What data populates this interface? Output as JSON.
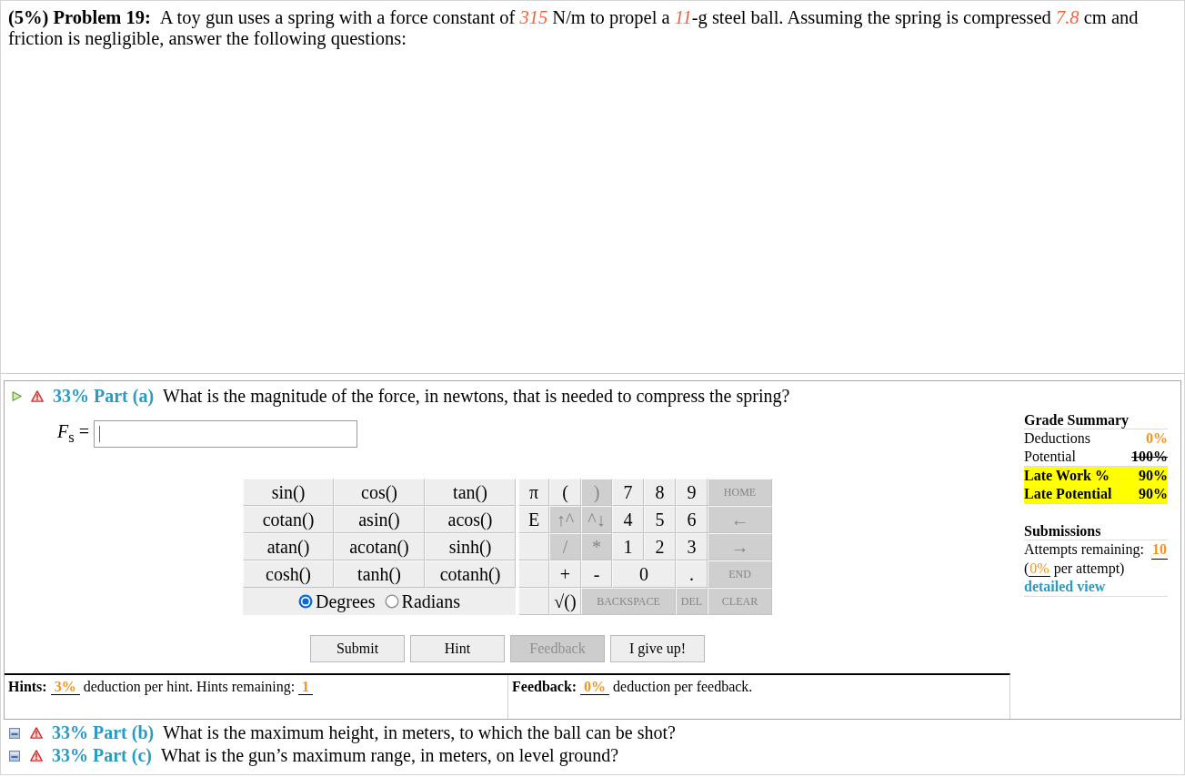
{
  "problem": {
    "heading": "(5%) Problem 19:",
    "statement": [
      {
        "text": "A toy gun uses a spring with a force constant of ",
        "kind": "plain"
      },
      {
        "text": "315",
        "kind": "given"
      },
      {
        "text": " N/m to propel a ",
        "kind": "plain"
      },
      {
        "text": "11",
        "kind": "given"
      },
      {
        "text": "-g steel ball. Assuming the spring is compressed ",
        "kind": "plain"
      },
      {
        "text": "7.8",
        "kind": "given"
      },
      {
        "text": " cm and friction is negligible, answer the following questions:",
        "kind": "plain"
      }
    ]
  },
  "parts": [
    {
      "label": "33% Part (a)",
      "question": "What is the magnitude of the force, in newtons, that is needed to compress the spring?",
      "expanded": true,
      "answer": {
        "variable": "*F*$_{s}$ =",
        "focused": true
      },
      "calculator": {
        "functions": [
          "sin()",
          "cos()",
          "tan()",
          "cotan()",
          "asin()",
          "acos()",
          "atan()",
          "acotan()",
          "sinh()",
          "cosh()",
          "tanh()",
          "cotanh()"
        ],
        "angle_modes": [
          {
            "label": "Degrees",
            "selected": true
          },
          {
            "label": "Radians",
            "selected": false
          }
        ],
        "keypad": [
          [
            {
              "label": "π",
              "kind": "key",
              "disabled": false
            },
            {
              "label": "(",
              "kind": "key",
              "disabled": false
            },
            {
              "label": ")",
              "kind": "key",
              "disabled": true
            },
            {
              "label": "7",
              "kind": "key",
              "disabled": false
            },
            {
              "label": "8",
              "kind": "key",
              "disabled": false
            },
            {
              "label": "9",
              "kind": "key",
              "disabled": false
            },
            {
              "label": "HOME",
              "kind": "command",
              "disabled": true
            }
          ],
          [
            {
              "label": "E",
              "kind": "key",
              "disabled": false
            },
            {
              "label": "↑^",
              "kind": "key",
              "disabled": true
            },
            {
              "label": "^↓",
              "kind": "key",
              "disabled": true
            },
            {
              "label": "4",
              "kind": "key",
              "disabled": false
            },
            {
              "label": "5",
              "kind": "key",
              "disabled": false
            },
            {
              "label": "6",
              "kind": "key",
              "disabled": false
            },
            {
              "label": "←",
              "kind": "key",
              "disabled": true
            }
          ],
          [
            {
              "kind": "blank",
              "disabled": false
            },
            {
              "label": "/",
              "kind": "key",
              "disabled": true
            },
            {
              "label": "*",
              "kind": "key",
              "disabled": true
            },
            {
              "label": "1",
              "kind": "key",
              "disabled": false
            },
            {
              "label": "2",
              "kind": "key",
              "disabled": false
            },
            {
              "label": "3",
              "kind": "key",
              "disabled": false
            },
            {
              "label": "→",
              "kind": "key",
              "disabled": true
            }
          ],
          [
            {
              "kind": "blank",
              "disabled": false
            },
            {
              "label": "+",
              "kind": "key",
              "disabled": false
            },
            {
              "label": "-",
              "kind": "key",
              "disabled": false
            },
            {
              "label": "0",
              "kind": "key",
              "disabled": false
            },
            {
              "label": ".",
              "kind": "key",
              "disabled": false
            },
            {
              "label": "END",
              "kind": "command",
              "disabled": true
            }
          ],
          [
            {
              "kind": "blank",
              "disabled": false
            },
            {
              "label": "√()",
              "kind": "key",
              "disabled": false
            },
            {
              "label": "BACKSPACE",
              "kind": "command",
              "disabled": true
            },
            {
              "label": "DEL",
              "kind": "command",
              "disabled": true
            },
            {
              "label": "CLEAR",
              "kind": "command",
              "disabled": true
            }
          ]
        ]
      },
      "buttons": [
        {
          "label": "Submit",
          "disabled": false
        },
        {
          "label": "Hint",
          "disabled": false
        },
        {
          "label": "Feedback",
          "disabled": true
        },
        {
          "label": "I give up!",
          "disabled": false
        }
      ],
      "hints": [
        {
          "text": "Hints: ",
          "kind": "label"
        },
        {
          "text": "3%",
          "kind": "value"
        },
        {
          "text": " deduction per hint. Hints remaining: ",
          "kind": "plain"
        },
        {
          "text": "1",
          "kind": "value"
        }
      ],
      "feedback": [
        {
          "text": "Feedback: ",
          "kind": "label"
        },
        {
          "text": "0%",
          "kind": "value"
        },
        {
          "text": " deduction per feedback.",
          "kind": "plain"
        }
      ],
      "grade_summary": {
        "title": "Grade Summary",
        "rows": [
          {
            "label": "Deductions",
            "value": "0%",
            "kind": "deduction"
          },
          {
            "label": "Potential",
            "value": "100%",
            "kind": "potential"
          },
          {
            "label": "Late Work %",
            "value": "90%",
            "kind": "late"
          },
          {
            "label": "Late Potential",
            "value": "90%",
            "kind": "late"
          }
        ]
      },
      "submissions": {
        "title": "Submissions",
        "attempts_label": "Attempts remaining:",
        "attempts": "10",
        "note": [
          {
            "text": "(",
            "kind": "plain"
          },
          {
            "text": "0%",
            "kind": "value"
          },
          {
            "text": " per attempt)",
            "kind": "plain"
          }
        ],
        "link": "detailed view"
      }
    },
    {
      "label": "33% Part (b)",
      "question": "What is the maximum height, in meters, to which the ball can be shot?",
      "expanded": false
    },
    {
      "label": "33% Part (c)",
      "question": "What is the gun’s maximum range, in meters, on level ground?",
      "expanded": false
    }
  ]
}
